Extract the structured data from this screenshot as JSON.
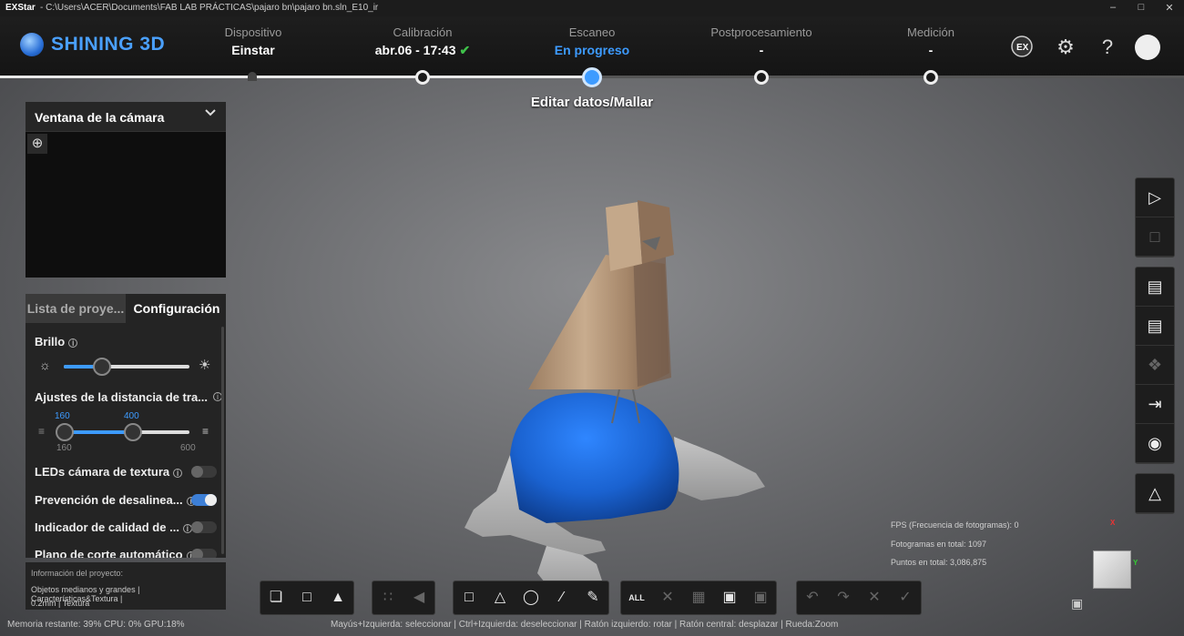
{
  "window": {
    "app": "EXStar",
    "path": "-  C:\\Users\\ACER\\Documents\\FAB LAB PRÁCTICAS\\pajaro bn\\pajaro bn.sln_E10_ir",
    "controls": [
      "–",
      "□",
      "✕"
    ]
  },
  "brand": {
    "name": "SHINING 3D"
  },
  "steps": [
    {
      "label": "Dispositivo",
      "value": "Einstar"
    },
    {
      "label": "Calibración",
      "value": "abr.06 - 17:43",
      "check": "✔"
    },
    {
      "label": "Escaneo",
      "value": "En progreso"
    },
    {
      "label": "Postprocesamiento",
      "value": "-"
    },
    {
      "label": "Medición",
      "value": "-"
    }
  ],
  "sub_status": "Editar datos/Mallar",
  "header_icons": [
    "ex-logo-icon",
    "gear-icon",
    "help-icon",
    "avatar"
  ],
  "camera": {
    "title": "Ventana de la cámara",
    "chevron": "⌄",
    "zoom": "⊕"
  },
  "config": {
    "tabs": [
      "Lista de proye...",
      "Configuración"
    ],
    "brightness": {
      "label": "Brillo",
      "low_icon": "☼",
      "high_icon": "☀",
      "fraction": 0.29
    },
    "distance": {
      "label": "Ajustes de la distancia de tra...",
      "min_value": "160",
      "max_value": "400",
      "range_min": "160",
      "range_max": "600"
    },
    "options": [
      {
        "label": "LEDs cámara de textura",
        "on": false
      },
      {
        "label": "Prevención de desalinea...",
        "on": true
      },
      {
        "label": "Indicador de calidad de ...",
        "on": false
      },
      {
        "label": "Plano de corte automático",
        "on": false
      }
    ]
  },
  "project_info": {
    "title": "Información del proyecto:",
    "line1": "Objetos medianos y grandes  |  Características&Textura  |",
    "line2": "0.2mm  |  Textura"
  },
  "status": {
    "resources": "Memoria restante: 39% CPU: 0% GPU:18%",
    "hints": "Mayús+Izquierda: seleccionar | Ctrl+Izquierda: deseleccionar | Ratón izquierdo: rotar | Ratón central: desplazar | Rueda:Zoom"
  },
  "stats": {
    "fps": "FPS (Frecuencia de fotogramas): 0",
    "frames": "Fotogramas en total: 1097",
    "points": "Puntos en total: 3,086,875"
  },
  "toolbar": {
    "all_label": "ALL"
  },
  "colors": {
    "accent": "#3d9bff",
    "check": "#3fc14a",
    "scan_blue": "#1a62d0"
  }
}
